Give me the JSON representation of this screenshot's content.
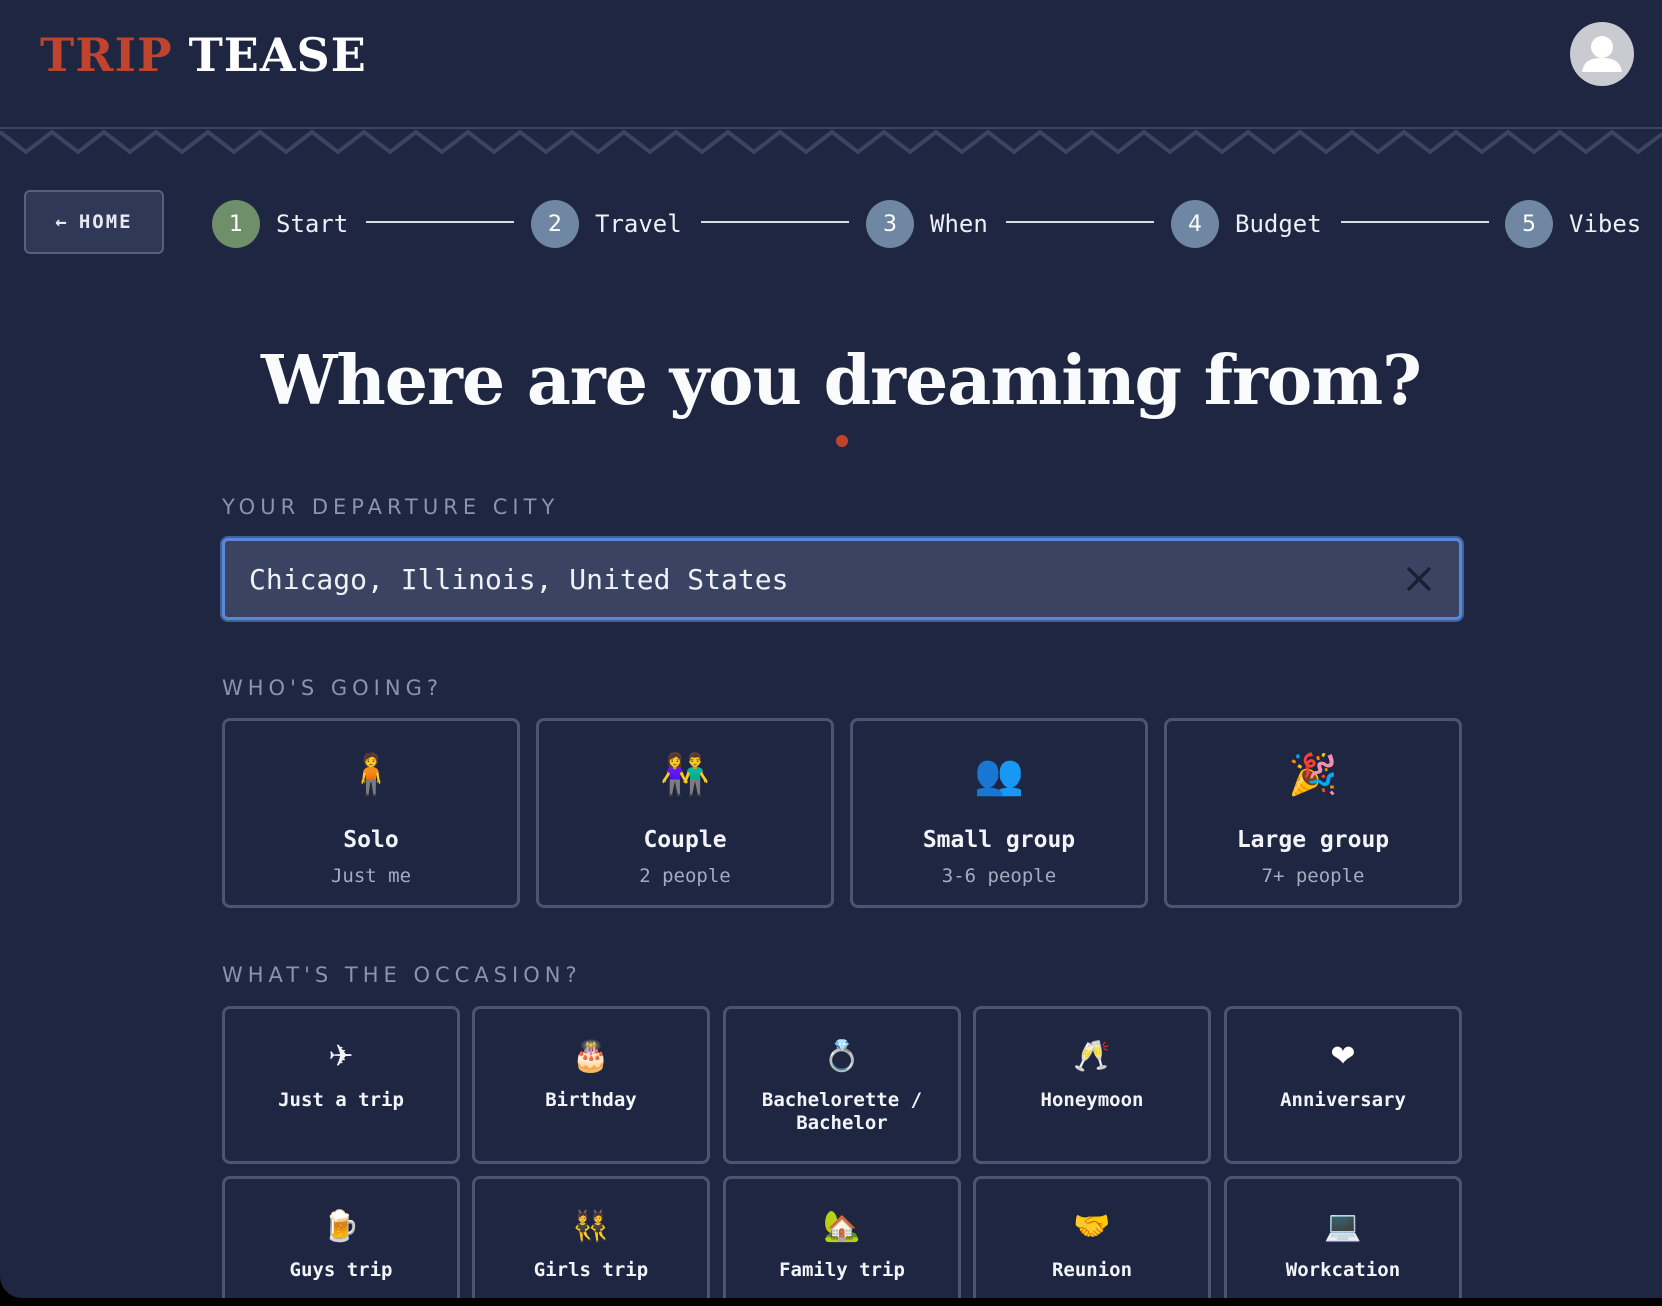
{
  "header": {
    "logo_part1": "TRIP",
    "logo_part2": "TEASE",
    "avatar_icon": "user-icon"
  },
  "nav": {
    "home_arrow": "←",
    "home_label": "HOME",
    "steps": [
      {
        "num": "1",
        "label": "Start",
        "state": "active"
      },
      {
        "num": "2",
        "label": "Travel",
        "state": "upcoming"
      },
      {
        "num": "3",
        "label": "When",
        "state": "upcoming"
      },
      {
        "num": "4",
        "label": "Budget",
        "state": "upcoming"
      },
      {
        "num": "5",
        "label": "Vibes",
        "state": "upcoming"
      }
    ]
  },
  "main": {
    "title": "Where are you dreaming from?",
    "departure": {
      "label": "YOUR DEPARTURE CITY",
      "value": "Chicago, Illinois, United States",
      "clear_icon": "close-icon"
    },
    "whos_going": {
      "label": "WHO'S GOING?",
      "options": [
        {
          "icon": "🧍",
          "title": "Solo",
          "sub": "Just me"
        },
        {
          "icon": "👫",
          "title": "Couple",
          "sub": "2 people"
        },
        {
          "icon": "👥",
          "title": "Small group",
          "sub": "3-6 people"
        },
        {
          "icon": "🎉",
          "title": "Large group",
          "sub": "7+ people"
        }
      ]
    },
    "occasion": {
      "label": "WHAT'S THE OCCASION?",
      "options": [
        {
          "icon": "✈",
          "title": "Just a trip"
        },
        {
          "icon": "🎂",
          "title": "Birthday"
        },
        {
          "icon": "💍",
          "title": "Bachelorette / Bachelor"
        },
        {
          "icon": "🥂",
          "title": "Honeymoon"
        },
        {
          "icon": "❤",
          "title": "Anniversary"
        },
        {
          "icon": "🍺",
          "title": "Guys trip"
        },
        {
          "icon": "👯",
          "title": "Girls trip"
        },
        {
          "icon": "🏡",
          "title": "Family trip"
        },
        {
          "icon": "🤝",
          "title": "Reunion"
        },
        {
          "icon": "💻",
          "title": "Workcation"
        }
      ]
    }
  },
  "colors": {
    "background": "#1e2642",
    "accent": "#c0432e",
    "step_active": "#6f8f6a",
    "step_upcoming": "#6f87a2",
    "input_focus": "#5b88d6"
  }
}
